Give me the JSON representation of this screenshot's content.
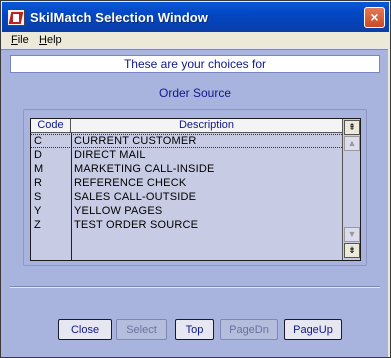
{
  "window": {
    "title": "SkilMatch Selection Window",
    "close_glyph": "×"
  },
  "menu": [
    {
      "accel": "F",
      "rest": "ile"
    },
    {
      "accel": "H",
      "rest": "elp"
    }
  ],
  "banner": "These are your choices for",
  "subtitle": "Order Source",
  "table": {
    "columns": [
      "Code",
      "Description"
    ],
    "rows": [
      {
        "code": "C",
        "description": "CURRENT CUSTOMER",
        "selected": true
      },
      {
        "code": "D",
        "description": "DIRECT MAIL"
      },
      {
        "code": "M",
        "description": "MARKETING CALL-INSIDE"
      },
      {
        "code": "R",
        "description": "REFERENCE CHECK"
      },
      {
        "code": "S",
        "description": "SALES CALL-OUTSIDE"
      },
      {
        "code": "Y",
        "description": "YELLOW PAGES"
      },
      {
        "code": "Z",
        "description": "TEST ORDER SOURCE"
      }
    ]
  },
  "scrollbar": {
    "top_glyph": "⇞",
    "up_glyph": "▲",
    "down_glyph": "▼",
    "bottom_glyph": "⇟"
  },
  "buttons": {
    "close": "Close",
    "select": "Select",
    "top": "Top",
    "pagedn": "PageDn",
    "pageup": "PageUp"
  }
}
